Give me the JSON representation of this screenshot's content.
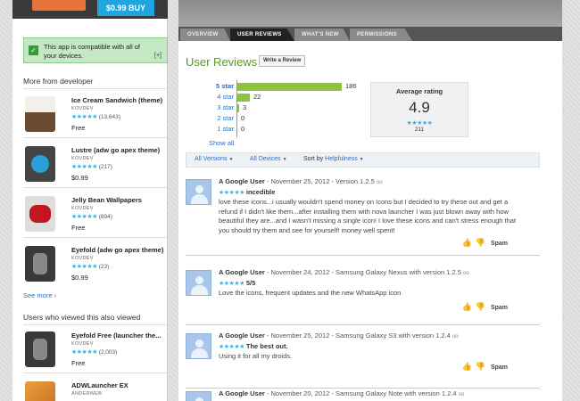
{
  "buy": {
    "label": "$0.99 BUY"
  },
  "compat": {
    "message": "This app is compatible with all of your devices.",
    "expand": "[+]"
  },
  "more_from_dev": {
    "title": "More from developer",
    "items": [
      {
        "name": "Ice Cream Sandwich (theme)",
        "developer": "KOVDEV",
        "count": "(13,643)",
        "price": "Free",
        "stars": "★★★★★"
      },
      {
        "name": "Lustre (adw go apex theme)",
        "developer": "KOVDEV",
        "count": "(217)",
        "price": "$0.99",
        "stars": "★★★★★"
      },
      {
        "name": "Jelly Bean Wallpapers",
        "developer": "KOVDEV",
        "count": "(894)",
        "price": "Free",
        "stars": "★★★★★"
      },
      {
        "name": "Eyefold (adw go apex theme)",
        "developer": "KOVDEV",
        "count": "(23)",
        "price": "$0.99",
        "stars": "★★★★★"
      }
    ],
    "see_more": "See more ›"
  },
  "also_viewed": {
    "title": "Users who viewed this also viewed",
    "items": [
      {
        "name": "Eyefold Free (launcher the...",
        "developer": "KOVDEV",
        "count": "(2,003)",
        "price": "Free",
        "stars": "★★★★★"
      },
      {
        "name": "ADWLauncher EX",
        "developer": "ANDERWEB"
      }
    ]
  },
  "tabs": [
    {
      "label": "OVERVIEW",
      "active": false
    },
    {
      "label": "USER REVIEWS",
      "active": true
    },
    {
      "label": "WHAT'S NEW",
      "active": false
    },
    {
      "label": "PERMISSIONS",
      "active": false
    }
  ],
  "reviews_section": {
    "title": "User Reviews",
    "write_button": "Write a Review"
  },
  "histogram": [
    {
      "label": "5 star",
      "count": "186",
      "value": 186
    },
    {
      "label": "4 star",
      "count": "22",
      "value": 22
    },
    {
      "label": "3 star",
      "count": "3",
      "value": 3
    },
    {
      "label": "2 star",
      "count": "0",
      "value": 0
    },
    {
      "label": "1 star",
      "count": "0",
      "value": 0
    }
  ],
  "show_all": "Show all",
  "average": {
    "title": "Average rating",
    "value": "4.9",
    "stars": "★★★★★",
    "count": "211"
  },
  "filters": {
    "versions": "All Versions",
    "devices": "All Devices",
    "sort_prefix": "Sort by",
    "sort_value": "Helpfulness"
  },
  "reviews": [
    {
      "author": "A Google User",
      "meta": " - November 25, 2012 - Version 1.2.5",
      "stars": "★★★★★",
      "title": "incedible",
      "text": "love these icons...i usually wouldn't spend money on Icons but I decided to try these out and get a refund if I didn't like them...after installing them with nova launcher I was just blown away with how beautiful they are...and I wasn't missing a single icon! I love these icons and can't stress enough that you should try them and see for yourself! money well spent!",
      "spam": "Spam"
    },
    {
      "author": "A Google User",
      "meta": " - November 24, 2012 - Samsung Galaxy Nexus with version 1.2.5",
      "stars": "★★★★★",
      "title": "5/5",
      "text": "Love the icons, frequent updates and the new WhatsApp icon",
      "spam": "Spam"
    },
    {
      "author": "A Google User",
      "meta": " - November 25, 2012 - Samsung Galaxy S3 with version 1.2.4",
      "stars": "★★★★★",
      "title": "The best out.",
      "text": "Using it for all my droids.",
      "spam": "Spam"
    },
    {
      "author": "A Google User",
      "meta": " - November 20, 2012 - Samsung Galaxy Note with version 1.2.4",
      "stars": "",
      "title": "",
      "text": "",
      "spam": ""
    }
  ],
  "colors": {
    "accent_green": "#5a9a1e",
    "bar_green": "#8cc43c",
    "star_blue": "#33b5e5",
    "buy_blue": "#1ea6e0",
    "link_blue": "#2a6ec5"
  }
}
